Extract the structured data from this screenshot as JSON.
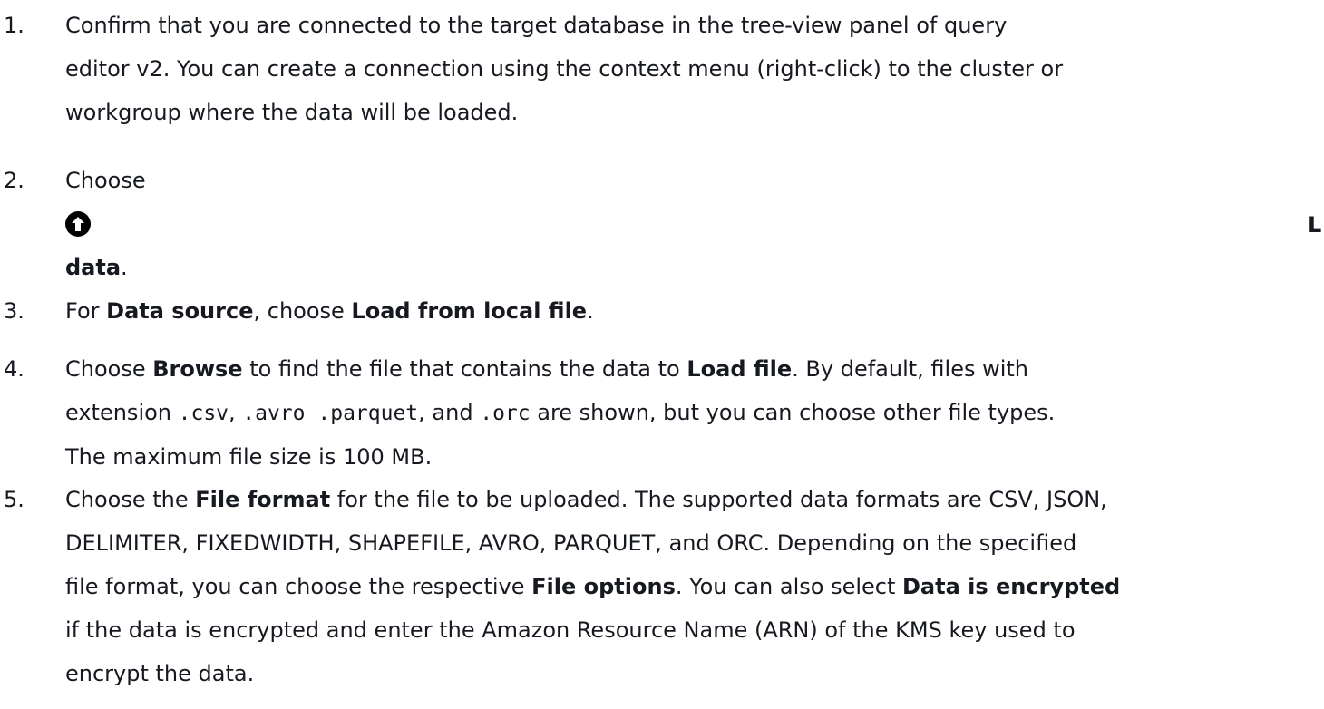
{
  "steps": [
    {
      "number": "1.",
      "lines": [
        "Confirm that you are connected to the target database in the tree-view panel of query",
        "editor v2. You can create a connection using the context menu (right-click) to the cluster or",
        "workgroup where the data will be loaded."
      ]
    },
    {
      "number": "2.",
      "text_before_icon": "Choose",
      "icon": "upload-arrow-icon",
      "text_after_icon_bold": "data",
      "text_after_icon_end": "."
    },
    {
      "number": "3.",
      "parts": [
        "For ",
        "Data source",
        ", choose ",
        "Load from local file",
        "."
      ]
    },
    {
      "number": "4.",
      "line1": [
        "Choose ",
        "Browse",
        " to find the file that contains the data to ",
        "Load file",
        ". By default, files with"
      ],
      "line2": [
        "extension ",
        ".csv",
        ", ",
        ".avro .parquet",
        ", and ",
        ".orc",
        " are shown, but you can choose other file types."
      ],
      "line3": "The maximum file size is 100 MB."
    },
    {
      "number": "5.",
      "line1": [
        "Choose the ",
        "File format",
        " for the file to be uploaded. The supported data formats are CSV, JSON,"
      ],
      "line2": "DELIMITER, FIXEDWIDTH, SHAPEFILE, AVRO, PARQUET, and ORC. Depending on the specified",
      "line3": [
        "file format, you can choose the respective ",
        "File options",
        ". You can also select ",
        "Data is encrypted"
      ],
      "line4": "if the data is encrypted and enter the Amazon Resource Name (ARN) of the KMS key used to",
      "line5": "encrypt the data."
    }
  ],
  "side_letter": "L"
}
